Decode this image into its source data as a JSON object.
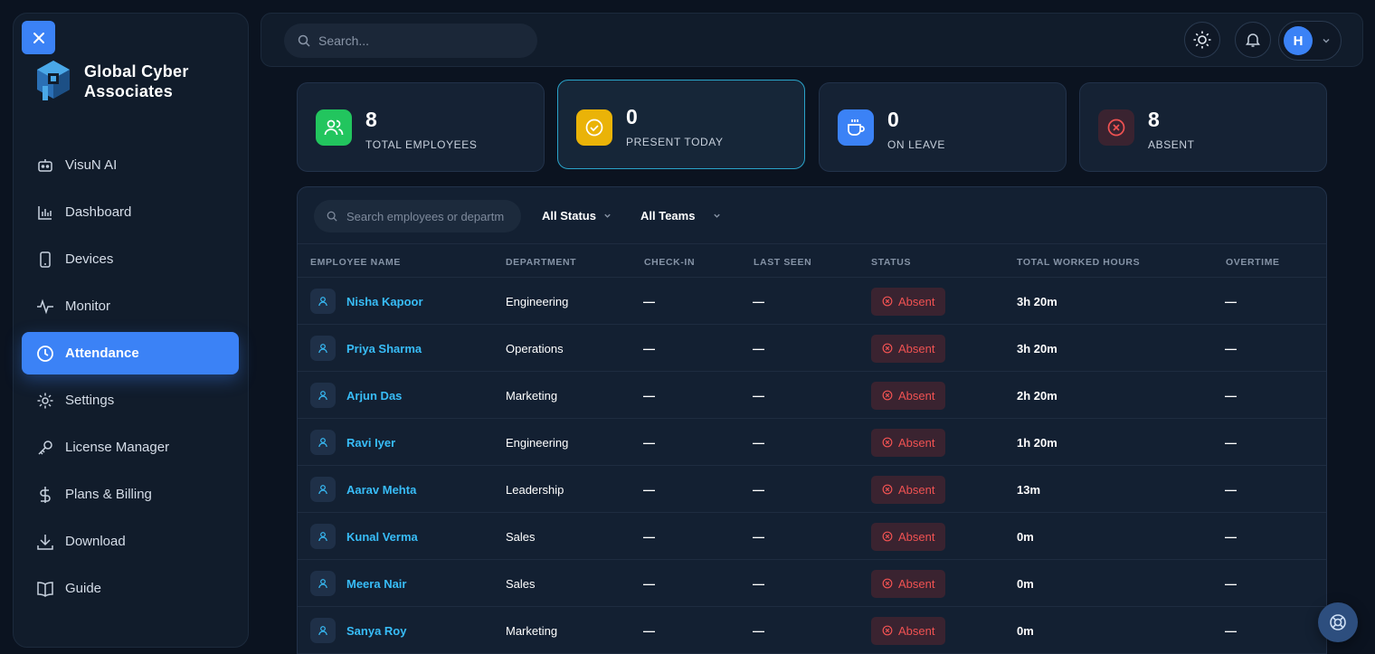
{
  "brand": {
    "name": "Global Cyber Associates"
  },
  "sidebar": {
    "items": [
      {
        "label": "VisuN AI",
        "icon": "bot-icon"
      },
      {
        "label": "Dashboard",
        "icon": "chart-icon"
      },
      {
        "label": "Devices",
        "icon": "device-icon"
      },
      {
        "label": "Monitor",
        "icon": "pulse-icon"
      },
      {
        "label": "Attendance",
        "icon": "clock-icon",
        "active": true
      },
      {
        "label": "Settings",
        "icon": "gear-icon"
      },
      {
        "label": "License Manager",
        "icon": "key-icon"
      },
      {
        "label": "Plans & Billing",
        "icon": "dollar-icon"
      },
      {
        "label": "Download",
        "icon": "download-icon"
      },
      {
        "label": "Guide",
        "icon": "book-icon"
      }
    ]
  },
  "topbar": {
    "search_placeholder": "Search...",
    "avatar_initial": "H"
  },
  "stats": [
    {
      "value": "8",
      "label": "TOTAL EMPLOYEES",
      "color": "#22c55e"
    },
    {
      "value": "0",
      "label": "PRESENT TODAY",
      "color": "#eab308"
    },
    {
      "value": "0",
      "label": "ON LEAVE",
      "color": "#3b82f6"
    },
    {
      "value": "8",
      "label": "ABSENT",
      "color": "#3a2330"
    }
  ],
  "table": {
    "search_placeholder": "Search employees or departm",
    "filters": {
      "status": "All Status",
      "teams": "All Teams"
    },
    "columns": [
      "EMPLOYEE NAME",
      "DEPARTMENT",
      "CHECK-IN",
      "LAST SEEN",
      "STATUS",
      "TOTAL WORKED HOURS",
      "OVERTIME"
    ],
    "rows": [
      {
        "name": "Nisha Kapoor",
        "department": "Engineering",
        "check_in": "—",
        "last_seen": "—",
        "status": "Absent",
        "hours": "3h 20m",
        "overtime": "—"
      },
      {
        "name": "Priya Sharma",
        "department": "Operations",
        "check_in": "—",
        "last_seen": "—",
        "status": "Absent",
        "hours": "3h 20m",
        "overtime": "—"
      },
      {
        "name": "Arjun Das",
        "department": "Marketing",
        "check_in": "—",
        "last_seen": "—",
        "status": "Absent",
        "hours": "2h 20m",
        "overtime": "—"
      },
      {
        "name": "Ravi Iyer",
        "department": "Engineering",
        "check_in": "—",
        "last_seen": "—",
        "status": "Absent",
        "hours": "1h 20m",
        "overtime": "—"
      },
      {
        "name": "Aarav Mehta",
        "department": "Leadership",
        "check_in": "—",
        "last_seen": "—",
        "status": "Absent",
        "hours": "13m",
        "overtime": "—"
      },
      {
        "name": "Kunal Verma",
        "department": "Sales",
        "check_in": "—",
        "last_seen": "—",
        "status": "Absent",
        "hours": "0m",
        "overtime": "—"
      },
      {
        "name": "Meera Nair",
        "department": "Sales",
        "check_in": "—",
        "last_seen": "—",
        "status": "Absent",
        "hours": "0m",
        "overtime": "—"
      },
      {
        "name": "Sanya Roy",
        "department": "Marketing",
        "check_in": "—",
        "last_seen": "—",
        "status": "Absent",
        "hours": "0m",
        "overtime": "—"
      }
    ]
  }
}
